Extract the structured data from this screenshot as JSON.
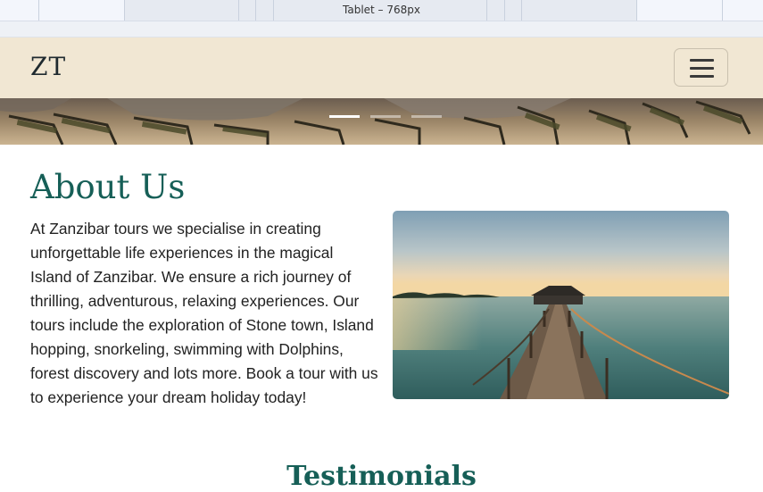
{
  "devtools": {
    "device_label": "Tablet – 768px"
  },
  "navbar": {
    "brand": "ZT",
    "toggler_icon": "hamburger-icon"
  },
  "hero": {
    "slides": 3,
    "active_slide": 1
  },
  "about": {
    "title": "About Us",
    "text": "At Zanzibar tours we specialise in creating unforgettable life experiences in the magical Island of Zanzibar. We ensure a rich journey of thrilling, adventurous, relaxing experiences. Our tours include the exploration of Stone town, Island hopping, snorkeling, swimming with Dolphins, forest discovery and lots more. Book a tour with us to experience your dream holiday today!"
  },
  "next_section": {
    "title": "Testimonials"
  },
  "colors": {
    "navbar_bg": "#f1e7d3",
    "heading": "#165f57",
    "text": "#222222"
  }
}
